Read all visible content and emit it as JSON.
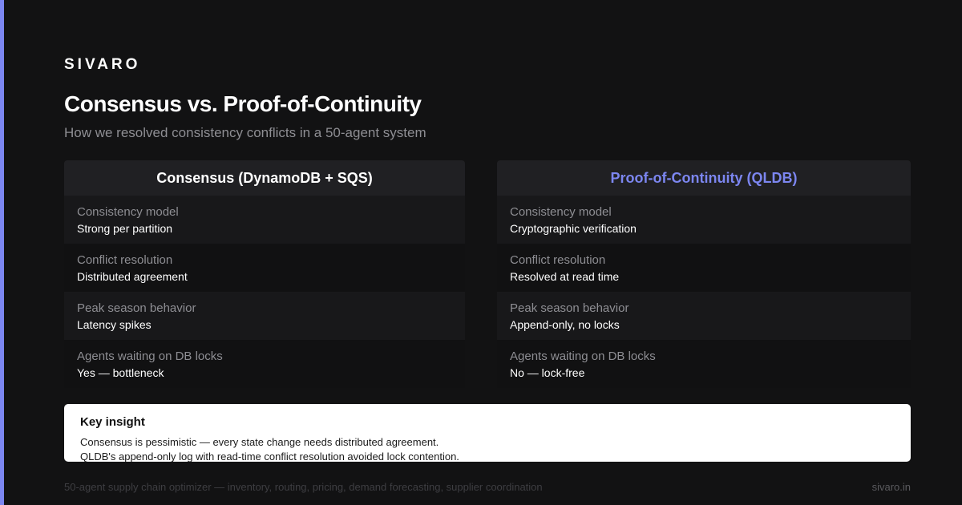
{
  "brand": "SIVARO",
  "title": "Consensus vs. Proof-of-Continuity",
  "subtitle": "How we resolved consistency conflicts in a 50-agent system",
  "colors": {
    "background": "#121213",
    "accent": "#7c86f0",
    "header_bg": "#202023",
    "row_odd": "#18181a",
    "row_even": "#111112",
    "muted_text": "#8e8e93"
  },
  "left": {
    "header": "Consensus (DynamoDB + SQS)",
    "rows": [
      {
        "label": "Consistency model",
        "value": "Strong per partition"
      },
      {
        "label": "Conflict resolution",
        "value": "Distributed agreement"
      },
      {
        "label": "Peak season behavior",
        "value": "Latency spikes"
      },
      {
        "label": "Agents waiting on DB locks",
        "value": "Yes — bottleneck"
      }
    ]
  },
  "right": {
    "header": "Proof-of-Continuity (QLDB)",
    "rows": [
      {
        "label": "Consistency model",
        "value": "Cryptographic verification"
      },
      {
        "label": "Conflict resolution",
        "value": "Resolved at read time"
      },
      {
        "label": "Peak season behavior",
        "value": "Append-only, no locks"
      },
      {
        "label": "Agents waiting on DB locks",
        "value": "No — lock-free"
      }
    ]
  },
  "insight": {
    "title": "Key insight",
    "line1": "Consensus is pessimistic — every state change needs distributed agreement.",
    "line2": "QLDB's append-only log with read-time conflict resolution avoided lock contention."
  },
  "footer": {
    "left": "50-agent supply chain optimizer — inventory, routing, pricing, demand forecasting, supplier coordination",
    "right": "sivaro.in"
  }
}
